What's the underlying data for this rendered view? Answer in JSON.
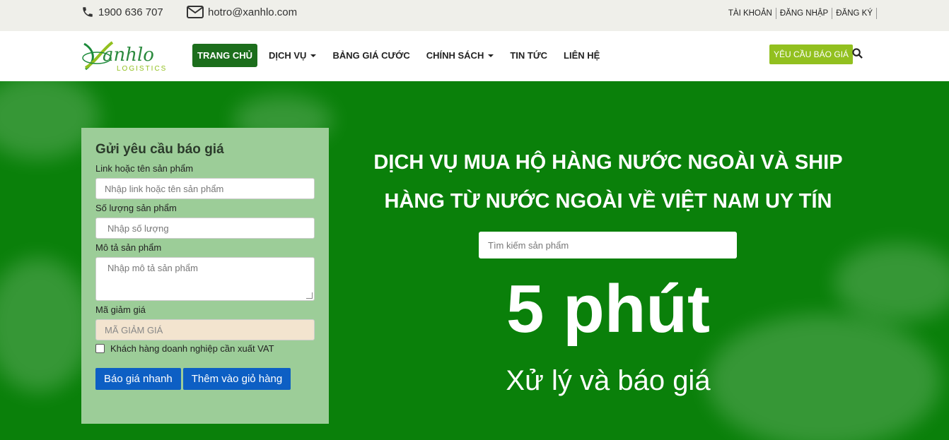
{
  "topbar": {
    "phone": "1900 636 707",
    "email": "hotro@xanhlo.com",
    "links": [
      "TÀI KHOẢN",
      "ĐĂNG NHẬP",
      "ĐĂNG KÝ"
    ]
  },
  "brand": {
    "logo_text": "Xanhlo",
    "logo_sub": "LOGISTICS",
    "accent": "#92c01f",
    "green": "#0a800a"
  },
  "nav": {
    "items": [
      "TRANG CHỦ",
      "DỊCH VỤ",
      "BẢNG GIÁ CƯỚC",
      "CHÍNH SÁCH",
      "TIN TỨC",
      "LIÊN HỆ"
    ],
    "quote_button": "YÊU CẦU BÁO GIÁ"
  },
  "form": {
    "title": "Gửi yêu cầu báo giá",
    "product_label": "Link hoặc tên sản phẩm",
    "product_placeholder": "Nhập link hoặc tên sản phẩm",
    "qty_label": "Số lượng sản phẩm",
    "qty_placeholder": "Nhập số lượng",
    "desc_label": "Mô tả sản phẩm",
    "desc_placeholder": "Nhập mô tả sản phẩm",
    "coupon_label": "Mã giảm giá",
    "coupon_placeholder": "MÃ GIẢM GIÁ",
    "vat_label": "Khách hàng doanh nghiệp cần xuất VAT",
    "btn_quick": "Báo giá nhanh",
    "btn_cart": "Thêm vào giỏ hàng"
  },
  "hero": {
    "title_line1": "DỊCH VỤ MUA HỘ HÀNG NƯỚC NGOÀI VÀ SHIP",
    "title_line2": "HÀNG TỪ NƯỚC NGOÀI VỀ VIỆT NAM UY TÍN",
    "search_placeholder": "Tìm kiếm sản phẩm",
    "big": "5 phút",
    "sub": "Xử lý và báo giá"
  }
}
